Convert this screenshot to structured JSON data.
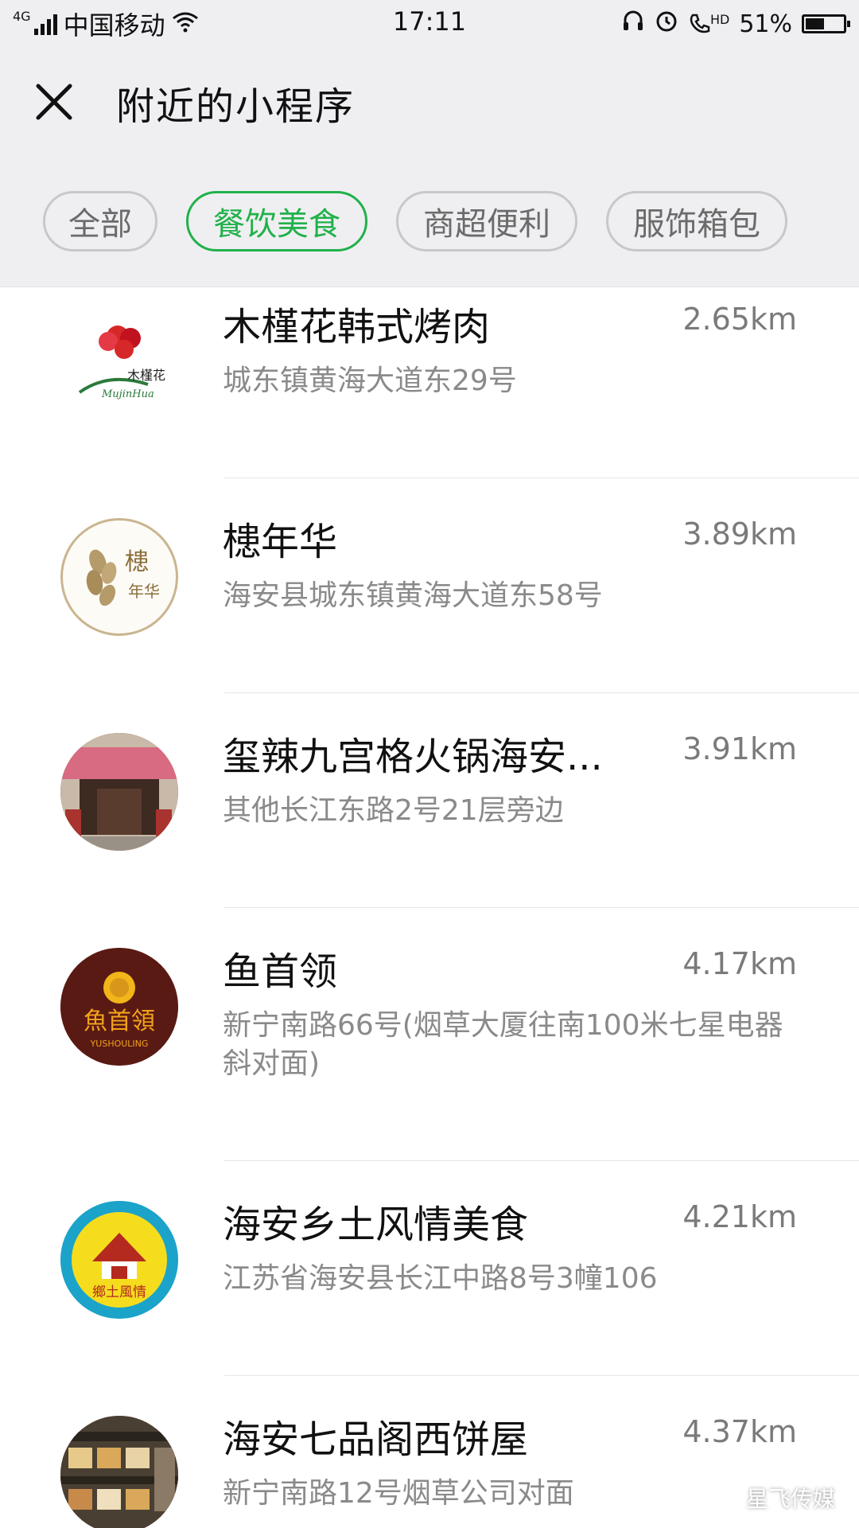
{
  "status_bar": {
    "network": "4G",
    "carrier": "中国移动",
    "time": "17:11",
    "hd_label": "HD",
    "battery_text": "51%",
    "battery_level": 0.51
  },
  "header": {
    "close_icon": "close-icon",
    "title": "附近的小程序"
  },
  "tabs": [
    {
      "label": "全部",
      "active": false
    },
    {
      "label": "餐饮美食",
      "active": true
    },
    {
      "label": "商超便利",
      "active": false
    },
    {
      "label": "服饰箱包",
      "active": false
    }
  ],
  "accent_color": "#21b14a",
  "items": [
    {
      "name": "木槿花韩式烤肉",
      "distance": "2.65km",
      "address": "城东镇黄海大道东29号"
    },
    {
      "name": "槵年华",
      "distance": "3.89km",
      "address": "海安县城东镇黄海大道东58号"
    },
    {
      "name": "玺辣九宫格火锅海安...",
      "distance": "3.91km",
      "address": "其他长江东路2号21层旁边"
    },
    {
      "name": "鱼首领",
      "distance": "4.17km",
      "address": "新宁南路66号(烟草大厦往南100米七星电器斜对面)"
    },
    {
      "name": "海安乡土风情美食",
      "distance": "4.21km",
      "address": "江苏省海安县长江中路8号3幢106"
    },
    {
      "name": "海安七品阁西饼屋",
      "distance": "4.37km",
      "address": "新宁南路12号烟草公司对面"
    }
  ],
  "logos": {
    "logo_0": {
      "text1": "木槿花",
      "text2": "MujinHua"
    },
    "logo_1": {
      "text1": "槵",
      "text2": "年华"
    },
    "logo_3": {
      "text1": "魚首領",
      "text2": "YUSHOULING"
    },
    "logo_4": {
      "text1": "鄉土風情"
    }
  },
  "watermark": "星飞传媒"
}
